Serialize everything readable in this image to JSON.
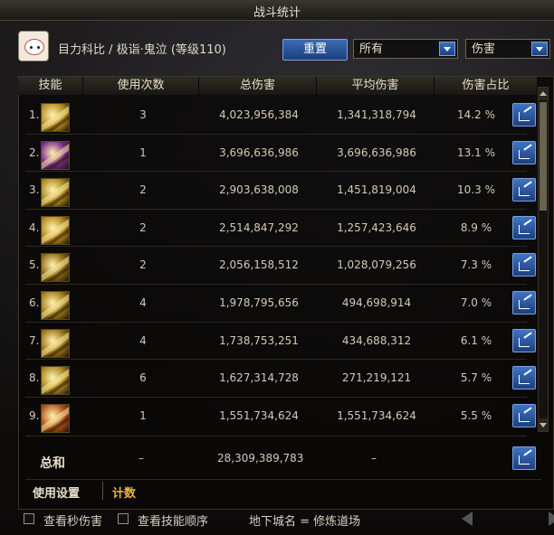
{
  "window": {
    "title": "战斗统计"
  },
  "character": {
    "line": "目力科比 / 极诣·鬼泣 (等级110)"
  },
  "controls": {
    "reset_label": "重置",
    "filter_select": "所有",
    "metric_select": "伤害"
  },
  "table": {
    "headers": [
      "技能",
      "使用次数",
      "总伤害",
      "平均伤害",
      "伤害占比"
    ],
    "rows": [
      {
        "rank": "1.",
        "uses": "3",
        "total": "4,023,956,384",
        "avg": "1,341,318,794",
        "share": "14.2 %",
        "icon_color": "#b58a20"
      },
      {
        "rank": "2.",
        "uses": "1",
        "total": "3,696,636,986",
        "avg": "3,696,636,986",
        "share": "13.1 %",
        "icon_color": "#7a2a8a"
      },
      {
        "rank": "3.",
        "uses": "2",
        "total": "2,903,638,008",
        "avg": "1,451,819,004",
        "share": "10.3 %",
        "icon_color": "#a8871c"
      },
      {
        "rank": "4.",
        "uses": "2",
        "total": "2,514,847,292",
        "avg": "1,257,423,646",
        "share": "8.9 %",
        "icon_color": "#b0861a"
      },
      {
        "rank": "5.",
        "uses": "2",
        "total": "2,056,158,512",
        "avg": "1,028,079,256",
        "share": "7.3 %",
        "icon_color": "#8c6a14"
      },
      {
        "rank": "6.",
        "uses": "4",
        "total": "1,978,795,656",
        "avg": "494,698,914",
        "share": "7.0 %",
        "icon_color": "#a07a18"
      },
      {
        "rank": "7.",
        "uses": "4",
        "total": "1,738,753,251",
        "avg": "434,688,312",
        "share": "6.1 %",
        "icon_color": "#9a7418"
      },
      {
        "rank": "8.",
        "uses": "6",
        "total": "1,627,314,728",
        "avg": "271,219,121",
        "share": "5.7 %",
        "icon_color": "#a8861e"
      },
      {
        "rank": "9.",
        "uses": "1",
        "total": "1,551,734,624",
        "avg": "1,551,734,624",
        "share": "5.5 %",
        "icon_color": "#b0501a"
      }
    ],
    "total": {
      "label": "总和",
      "uses": "–",
      "total": "28,309,389,783",
      "avg": "–"
    }
  },
  "tabs": {
    "usage": "使用设置",
    "count": "计数"
  },
  "footer": {
    "check_per_second": "查看秒伤害",
    "check_skill_order": "查看技能顺序",
    "dungeon": "地下城名 = 修炼道场"
  },
  "colors": {
    "accent_blue": "#2d5aa0",
    "highlight_tab": "#f0b43b"
  }
}
